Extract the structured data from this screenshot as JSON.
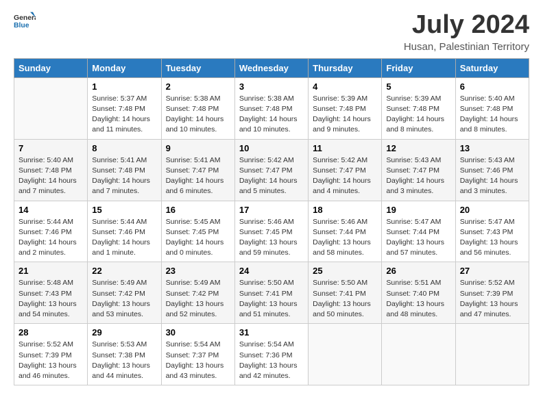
{
  "logo": {
    "line1": "General",
    "line2": "Blue"
  },
  "title": "July 2024",
  "subtitle": "Husan, Palestinian Territory",
  "days_of_week": [
    "Sunday",
    "Monday",
    "Tuesday",
    "Wednesday",
    "Thursday",
    "Friday",
    "Saturday"
  ],
  "weeks": [
    [
      {
        "day": "",
        "info": ""
      },
      {
        "day": "1",
        "info": "Sunrise: 5:37 AM\nSunset: 7:48 PM\nDaylight: 14 hours\nand 11 minutes."
      },
      {
        "day": "2",
        "info": "Sunrise: 5:38 AM\nSunset: 7:48 PM\nDaylight: 14 hours\nand 10 minutes."
      },
      {
        "day": "3",
        "info": "Sunrise: 5:38 AM\nSunset: 7:48 PM\nDaylight: 14 hours\nand 10 minutes."
      },
      {
        "day": "4",
        "info": "Sunrise: 5:39 AM\nSunset: 7:48 PM\nDaylight: 14 hours\nand 9 minutes."
      },
      {
        "day": "5",
        "info": "Sunrise: 5:39 AM\nSunset: 7:48 PM\nDaylight: 14 hours\nand 8 minutes."
      },
      {
        "day": "6",
        "info": "Sunrise: 5:40 AM\nSunset: 7:48 PM\nDaylight: 14 hours\nand 8 minutes."
      }
    ],
    [
      {
        "day": "7",
        "info": "Sunrise: 5:40 AM\nSunset: 7:48 PM\nDaylight: 14 hours\nand 7 minutes."
      },
      {
        "day": "8",
        "info": "Sunrise: 5:41 AM\nSunset: 7:48 PM\nDaylight: 14 hours\nand 7 minutes."
      },
      {
        "day": "9",
        "info": "Sunrise: 5:41 AM\nSunset: 7:47 PM\nDaylight: 14 hours\nand 6 minutes."
      },
      {
        "day": "10",
        "info": "Sunrise: 5:42 AM\nSunset: 7:47 PM\nDaylight: 14 hours\nand 5 minutes."
      },
      {
        "day": "11",
        "info": "Sunrise: 5:42 AM\nSunset: 7:47 PM\nDaylight: 14 hours\nand 4 minutes."
      },
      {
        "day": "12",
        "info": "Sunrise: 5:43 AM\nSunset: 7:47 PM\nDaylight: 14 hours\nand 3 minutes."
      },
      {
        "day": "13",
        "info": "Sunrise: 5:43 AM\nSunset: 7:46 PM\nDaylight: 14 hours\nand 3 minutes."
      }
    ],
    [
      {
        "day": "14",
        "info": "Sunrise: 5:44 AM\nSunset: 7:46 PM\nDaylight: 14 hours\nand 2 minutes."
      },
      {
        "day": "15",
        "info": "Sunrise: 5:44 AM\nSunset: 7:46 PM\nDaylight: 14 hours\nand 1 minute."
      },
      {
        "day": "16",
        "info": "Sunrise: 5:45 AM\nSunset: 7:45 PM\nDaylight: 14 hours\nand 0 minutes."
      },
      {
        "day": "17",
        "info": "Sunrise: 5:46 AM\nSunset: 7:45 PM\nDaylight: 13 hours\nand 59 minutes."
      },
      {
        "day": "18",
        "info": "Sunrise: 5:46 AM\nSunset: 7:44 PM\nDaylight: 13 hours\nand 58 minutes."
      },
      {
        "day": "19",
        "info": "Sunrise: 5:47 AM\nSunset: 7:44 PM\nDaylight: 13 hours\nand 57 minutes."
      },
      {
        "day": "20",
        "info": "Sunrise: 5:47 AM\nSunset: 7:43 PM\nDaylight: 13 hours\nand 56 minutes."
      }
    ],
    [
      {
        "day": "21",
        "info": "Sunrise: 5:48 AM\nSunset: 7:43 PM\nDaylight: 13 hours\nand 54 minutes."
      },
      {
        "day": "22",
        "info": "Sunrise: 5:49 AM\nSunset: 7:42 PM\nDaylight: 13 hours\nand 53 minutes."
      },
      {
        "day": "23",
        "info": "Sunrise: 5:49 AM\nSunset: 7:42 PM\nDaylight: 13 hours\nand 52 minutes."
      },
      {
        "day": "24",
        "info": "Sunrise: 5:50 AM\nSunset: 7:41 PM\nDaylight: 13 hours\nand 51 minutes."
      },
      {
        "day": "25",
        "info": "Sunrise: 5:50 AM\nSunset: 7:41 PM\nDaylight: 13 hours\nand 50 minutes."
      },
      {
        "day": "26",
        "info": "Sunrise: 5:51 AM\nSunset: 7:40 PM\nDaylight: 13 hours\nand 48 minutes."
      },
      {
        "day": "27",
        "info": "Sunrise: 5:52 AM\nSunset: 7:39 PM\nDaylight: 13 hours\nand 47 minutes."
      }
    ],
    [
      {
        "day": "28",
        "info": "Sunrise: 5:52 AM\nSunset: 7:39 PM\nDaylight: 13 hours\nand 46 minutes."
      },
      {
        "day": "29",
        "info": "Sunrise: 5:53 AM\nSunset: 7:38 PM\nDaylight: 13 hours\nand 44 minutes."
      },
      {
        "day": "30",
        "info": "Sunrise: 5:54 AM\nSunset: 7:37 PM\nDaylight: 13 hours\nand 43 minutes."
      },
      {
        "day": "31",
        "info": "Sunrise: 5:54 AM\nSunset: 7:36 PM\nDaylight: 13 hours\nand 42 minutes."
      },
      {
        "day": "",
        "info": ""
      },
      {
        "day": "",
        "info": ""
      },
      {
        "day": "",
        "info": ""
      }
    ]
  ]
}
